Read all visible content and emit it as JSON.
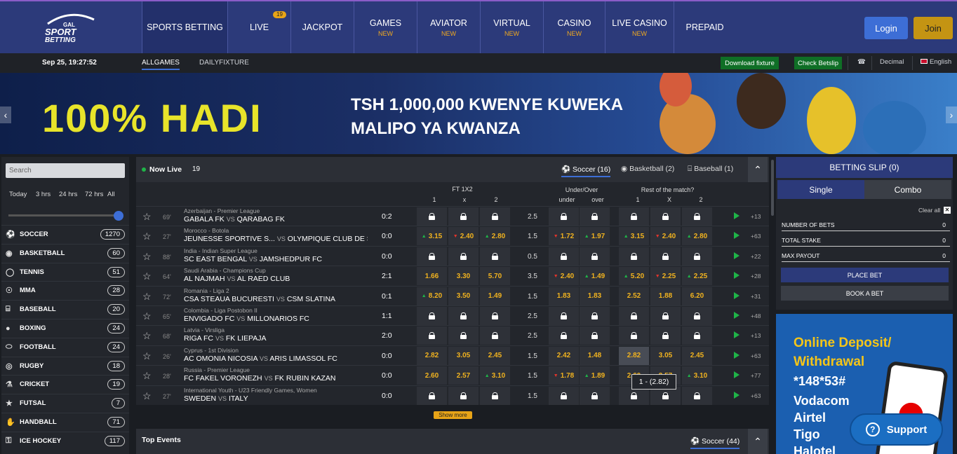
{
  "nav": {
    "logo": "GAL SPORT BETTING",
    "items": [
      {
        "label": "SPORTS BETTING",
        "sub": "",
        "badge": "",
        "active": true
      },
      {
        "label": "LIVE",
        "sub": "",
        "badge": "19"
      },
      {
        "label": "JACKPOT",
        "sub": "",
        "badge": ""
      },
      {
        "label": "GAMES",
        "sub": "NEW",
        "badge": ""
      },
      {
        "label": "AVIATOR",
        "sub": "NEW",
        "badge": ""
      },
      {
        "label": "VIRTUAL",
        "sub": "NEW",
        "badge": ""
      },
      {
        "label": "CASINO",
        "sub": "NEW",
        "badge": ""
      },
      {
        "label": "LIVE CASINO",
        "sub": "NEW",
        "badge": ""
      },
      {
        "label": "PREPAID",
        "sub": "",
        "badge": ""
      }
    ],
    "login": "Login",
    "join": "Join"
  },
  "subbar": {
    "datetime": "Sep 25, 19:27:52",
    "tabs": [
      "ALLGAMES",
      "DAILYFIXTURE"
    ],
    "download": "Download fixture",
    "check": "Check Betslip",
    "odds_format": "Decimal",
    "language": "English"
  },
  "banner": {
    "big": "100% HADI",
    "line1": "TSH 1,000,000 KWENYE KUWEKA",
    "line2": "MALIPO YA KWANZA"
  },
  "sidebar": {
    "search_placeholder": "Search",
    "time_filters": [
      "Today",
      "3 hrs",
      "24 hrs",
      "72 hrs",
      "All"
    ],
    "sports": [
      {
        "name": "SOCCER",
        "count": "1270",
        "icon": "soccer-ball-icon"
      },
      {
        "name": "BASKETBALL",
        "count": "60",
        "icon": "basketball-icon"
      },
      {
        "name": "TENNIS",
        "count": "51",
        "icon": "tennis-ball-icon"
      },
      {
        "name": "MMA",
        "count": "28",
        "icon": "fighter-icon"
      },
      {
        "name": "BASEBALL",
        "count": "20",
        "icon": "baseball-icon"
      },
      {
        "name": "BOXING",
        "count": "24",
        "icon": "boxing-glove-icon"
      },
      {
        "name": "FOOTBALL",
        "count": "24",
        "icon": "american-football-icon"
      },
      {
        "name": "RUGBY",
        "count": "18",
        "icon": "rugby-ball-icon"
      },
      {
        "name": "CRICKET",
        "count": "19",
        "icon": "cricket-icon"
      },
      {
        "name": "FUTSAL",
        "count": "7",
        "icon": "futsal-icon"
      },
      {
        "name": "HANDBALL",
        "count": "71",
        "icon": "handball-icon"
      },
      {
        "name": "ICE HOCKEY",
        "count": "117",
        "icon": "hockey-icon"
      }
    ]
  },
  "live": {
    "title": "Now Live",
    "count": "19",
    "sport_tabs": [
      {
        "label": "Soccer (16)",
        "icon": "soccer-ball-icon"
      },
      {
        "label": "Basketball (2)",
        "icon": "basketball-icon"
      },
      {
        "label": "Baseball (1)",
        "icon": "baseball-icon"
      }
    ],
    "headers": {
      "ft": "FT 1X2",
      "uo": "Under/Over",
      "rest": "Rest of the match?",
      "ft_cols": [
        "1",
        "x",
        "2"
      ],
      "uo_cols": [
        "under",
        "over"
      ],
      "rest_cols": [
        "1",
        "X",
        "2"
      ]
    },
    "matches": [
      {
        "min": "69'",
        "league": "Azerbaijan - Premier League",
        "home": "GABALA FK",
        "vs": "VS",
        "away": "QARABAG FK",
        "score": "0:2",
        "ft": [
          "L",
          "L",
          "L"
        ],
        "line": "2.5",
        "uo": [
          "L",
          "L"
        ],
        "rest": [
          "L",
          "L",
          "L"
        ],
        "more": "+13"
      },
      {
        "min": "27'",
        "league": "Morocco - Botola",
        "home": "JEUNESSE SPORTIVE S...",
        "vs": "VS",
        "away": "OLYMPIQUE CLUB DE S...",
        "score": "0:0",
        "ft": [
          "^3.15",
          "v2.40",
          "^2.80"
        ],
        "line": "1.5",
        "uo": [
          "v1.72",
          "^1.97"
        ],
        "rest": [
          "^3.15",
          "v2.40",
          "^2.80"
        ],
        "more": "+63"
      },
      {
        "min": "88'",
        "league": "India - Indian Super League",
        "home": "SC EAST BENGAL",
        "vs": "VS",
        "away": "JAMSHEDPUR FC",
        "score": "0:0",
        "ft": [
          "L",
          "L",
          "L"
        ],
        "line": "0.5",
        "uo": [
          "L",
          "L"
        ],
        "rest": [
          "L",
          "L",
          "L"
        ],
        "more": "+22"
      },
      {
        "min": "64'",
        "league": "Saudi Arabia - Champions Cup",
        "home": "AL NAJMAH",
        "vs": "VS",
        "away": "AL RAED CLUB",
        "score": "2:1",
        "ft": [
          "1.66",
          "3.30",
          "5.70"
        ],
        "line": "3.5",
        "uo": [
          "v2.40",
          "^1.49"
        ],
        "rest": [
          "^5.20",
          "v2.25",
          "^2.25"
        ],
        "more": "+28"
      },
      {
        "min": "72'",
        "league": "Romania - Liga 2",
        "home": "CSA STEAUA BUCURESTI",
        "vs": "VS",
        "away": "CSM SLATINA",
        "score": "0:1",
        "ft": [
          "^8.20",
          "3.50",
          "1.49"
        ],
        "line": "1.5",
        "uo": [
          "1.83",
          "1.83"
        ],
        "rest": [
          "2.52",
          "1.88",
          "6.20"
        ],
        "more": "+31"
      },
      {
        "min": "65'",
        "league": "Colombia - Liga Postobon II",
        "home": "ENVIGADO FC",
        "vs": "VS",
        "away": "MILLONARIOS FC",
        "score": "1:1",
        "ft": [
          "L",
          "L",
          "L"
        ],
        "line": "2.5",
        "uo": [
          "L",
          "L"
        ],
        "rest": [
          "L",
          "L",
          "L"
        ],
        "more": "+48"
      },
      {
        "min": "68'",
        "league": "Latvia - Virsliga",
        "home": "RIGA FC",
        "vs": "VS",
        "away": "FK LIEPAJA",
        "score": "2:0",
        "ft": [
          "L",
          "L",
          "L"
        ],
        "line": "2.5",
        "uo": [
          "L",
          "L"
        ],
        "rest": [
          "L",
          "L",
          "L"
        ],
        "more": "+13"
      },
      {
        "min": "26'",
        "league": "Cyprus - 1st Division",
        "home": "AC OMONIA NICOSIA",
        "vs": "VS",
        "away": "ARIS LIMASSOL FC",
        "score": "0:0",
        "ft": [
          "2.82",
          "3.05",
          "2.45"
        ],
        "line": "1.5",
        "uo": [
          "2.42",
          "1.48"
        ],
        "rest": [
          "*2.82",
          "3.05",
          "2.45"
        ],
        "more": "+63"
      },
      {
        "min": "28'",
        "league": "Russia - Premier League",
        "home": "FC FAKEL VORONEZH",
        "vs": "VS",
        "away": "FK RUBIN KAZAN",
        "score": "0:0",
        "ft": [
          "2.60",
          "2.57",
          "^3.10"
        ],
        "line": "1.5",
        "uo": [
          "v1.78",
          "^1.89"
        ],
        "rest": [
          "2.60",
          "2.57",
          "^3.10"
        ],
        "more": "+77"
      },
      {
        "min": "27'",
        "league": "International Youth - U23 Friendly Games, Women",
        "home": "SWEDEN",
        "vs": "VS",
        "away": "ITALY",
        "score": "0:0",
        "ft": [
          "L",
          "L",
          "L"
        ],
        "line": "1.5",
        "uo": [
          "L",
          "L"
        ],
        "rest": [
          "L",
          "L",
          "L"
        ],
        "more": "+63"
      }
    ],
    "tooltip": "1 - (2.82)",
    "show_more": "Show more"
  },
  "top_events": {
    "title": "Top Events",
    "tab": "Soccer (44)"
  },
  "betslip": {
    "title": "BETTING SLIP (0)",
    "single": "Single",
    "combo": "Combo",
    "clear": "Clear all",
    "lines": [
      {
        "label": "NUMBER OF BETS",
        "value": "0"
      },
      {
        "label": "TOTAL STAKE",
        "value": "0"
      },
      {
        "label": "MAX PAYOUT",
        "value": "0"
      }
    ],
    "place": "PLACE BET",
    "book": "BOOK A BET"
  },
  "promo": {
    "h1": "Online Deposit/",
    "h2": "Withdrawal",
    "code": "*148*53#",
    "ops": [
      "Vodacom",
      "Airtel",
      "Tigo",
      "Halotel"
    ]
  },
  "support": "Support",
  "colors": {
    "nav": "#2c3a7a",
    "accent": "#3d6ed6",
    "gold": "#f0b21f",
    "green": "#1fb448",
    "red": "#e0342c"
  }
}
